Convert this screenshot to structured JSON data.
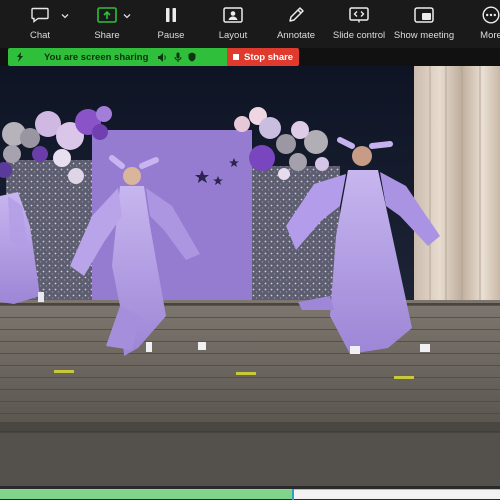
{
  "toolbar": {
    "items": [
      {
        "label": "Chat",
        "icon": "chat-icon"
      },
      {
        "label": "Share",
        "icon": "share-screen-icon"
      },
      {
        "label": "Pause",
        "icon": "pause-icon"
      },
      {
        "label": "Layout",
        "icon": "layout-icon"
      },
      {
        "label": "Annotate",
        "icon": "pencil-icon"
      },
      {
        "label": "Slide control",
        "icon": "slide-control-icon"
      },
      {
        "label": "Show meeting",
        "icon": "show-meeting-icon"
      },
      {
        "label": "More",
        "icon": "more-icon"
      }
    ],
    "accent": "#2fbf3a"
  },
  "sharing": {
    "status": "You are screen sharing",
    "stop_label": "Stop share",
    "green": "#2fbf3a",
    "red": "#e0392d"
  },
  "video": {
    "progress": 0.585
  }
}
